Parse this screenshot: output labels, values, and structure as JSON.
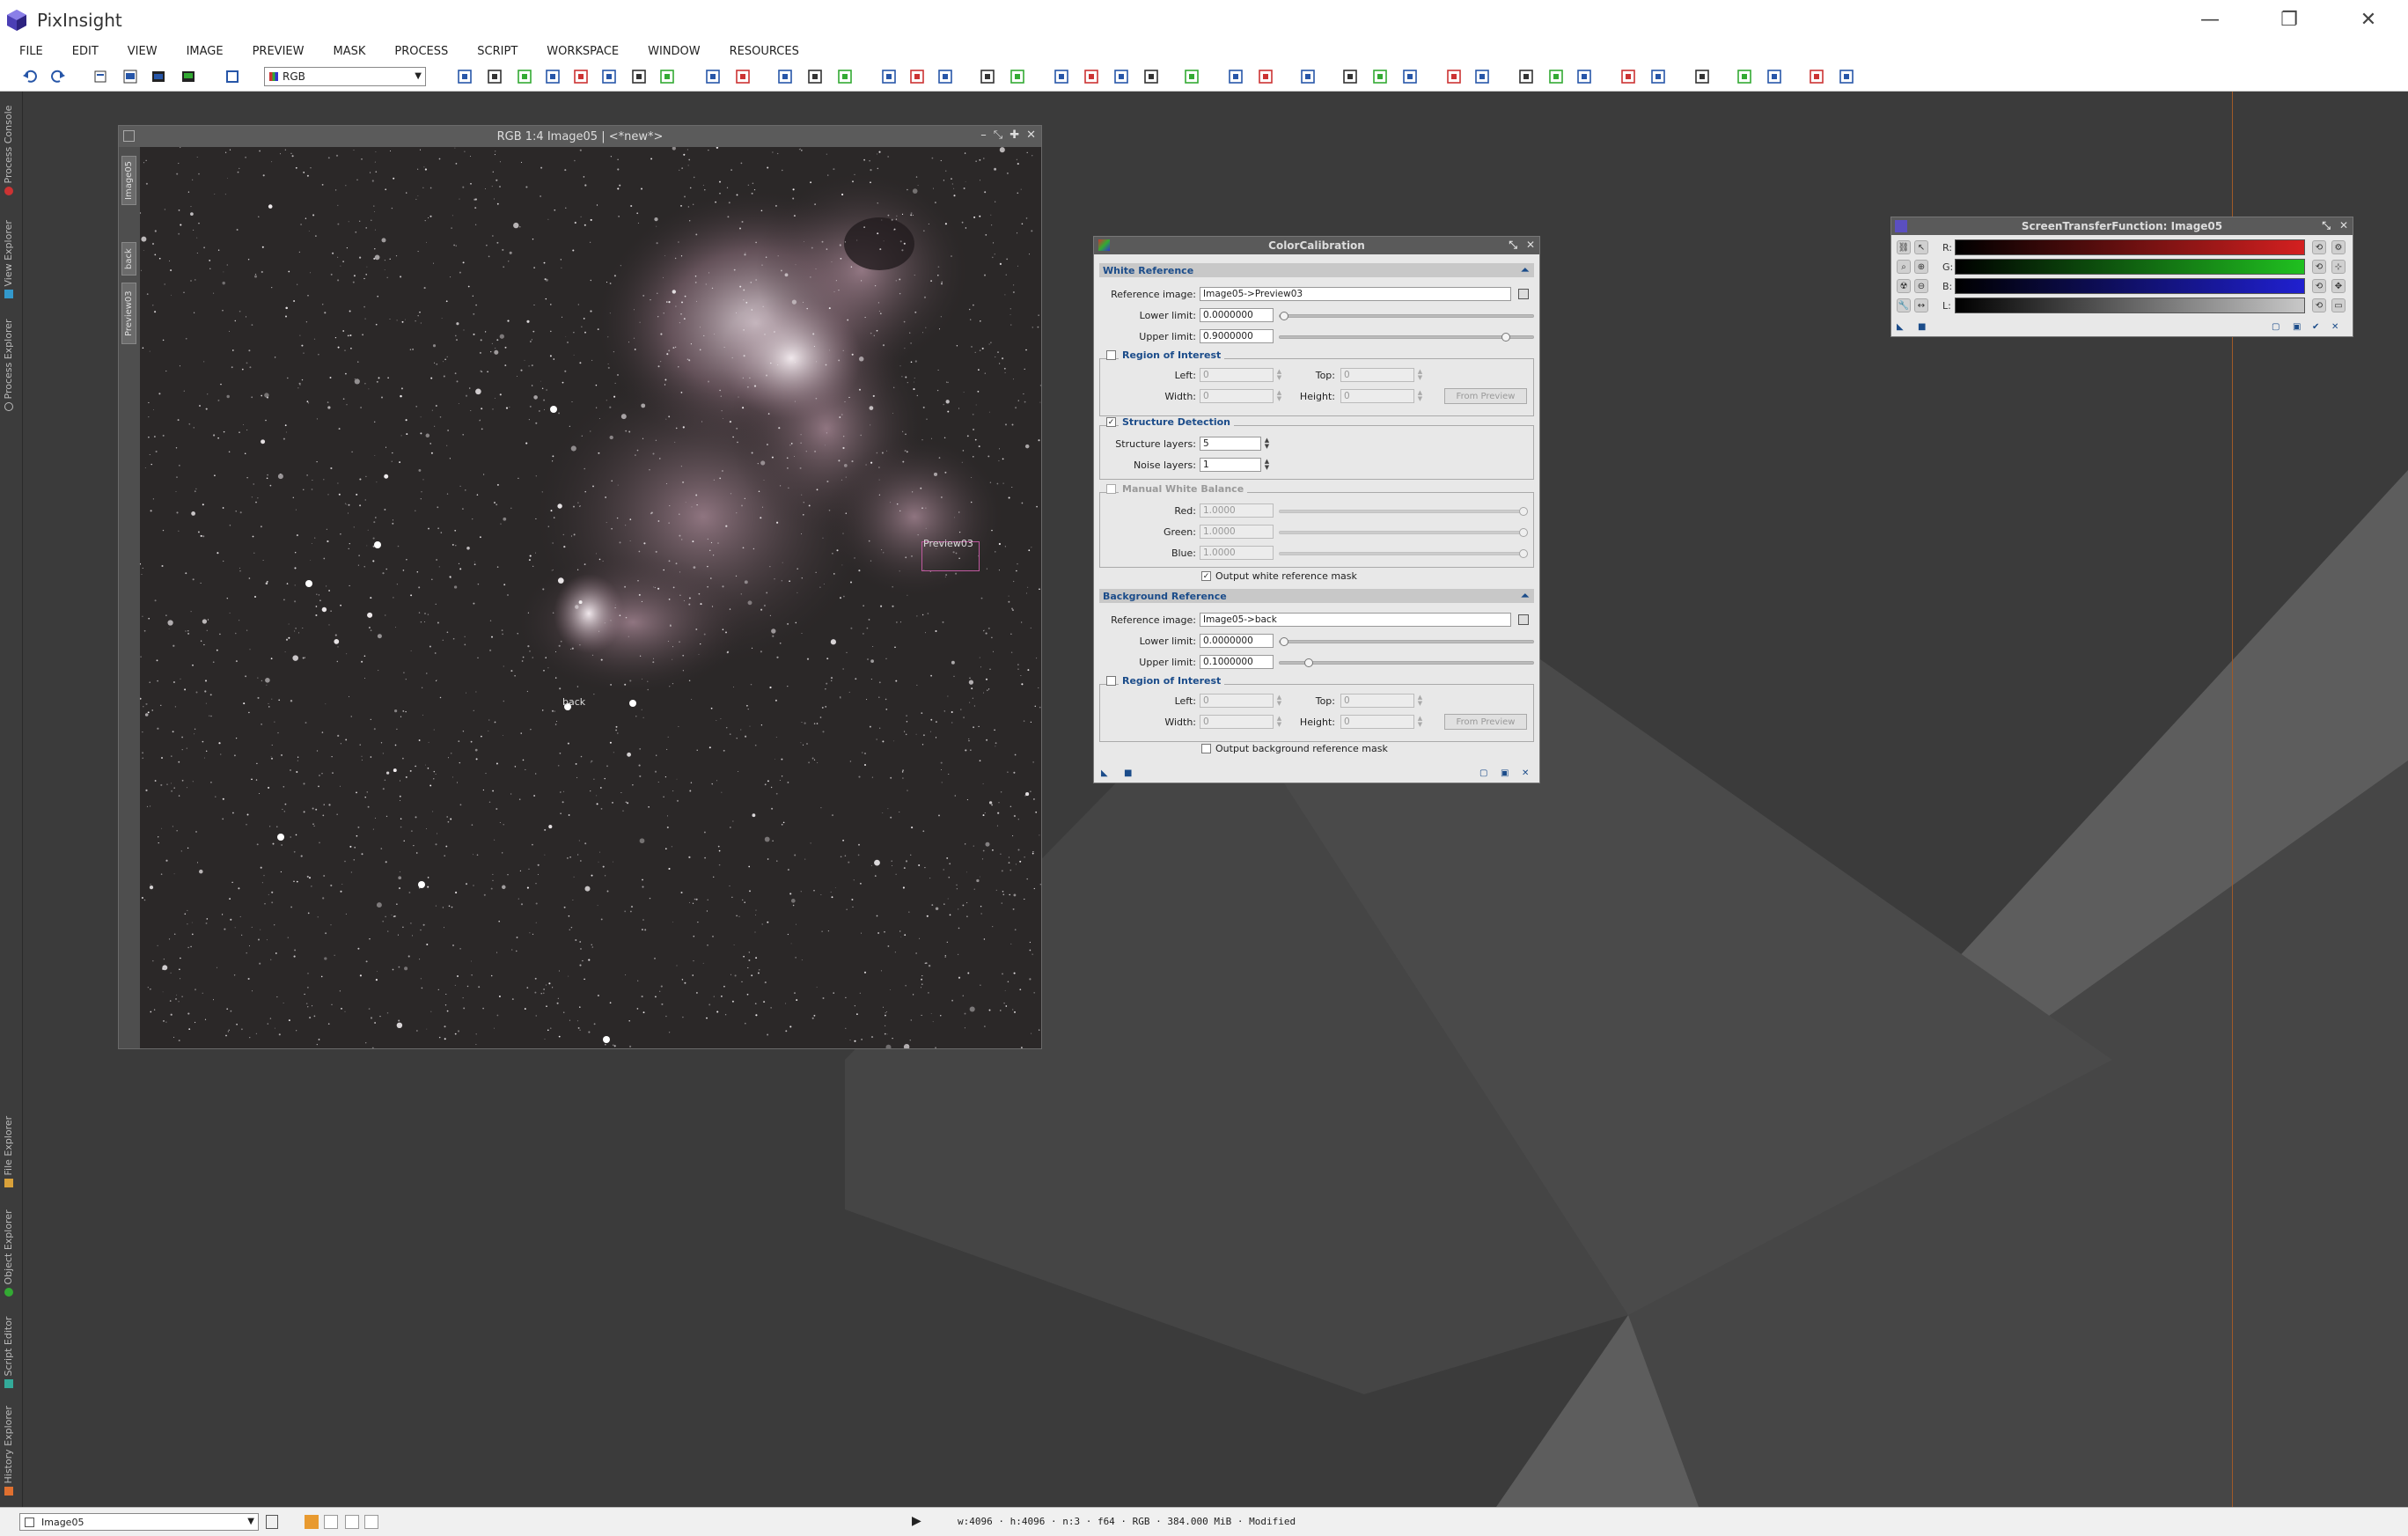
{
  "app": {
    "title": "PixInsight"
  },
  "window_buttons": {
    "minimize": "—",
    "restore": "❐",
    "close": "✕"
  },
  "menu": [
    "FILE",
    "EDIT",
    "VIEW",
    "IMAGE",
    "PREVIEW",
    "MASK",
    "PROCESS",
    "SCRIPT",
    "WORKSPACE",
    "WINDOW",
    "RESOURCES"
  ],
  "toolbar": {
    "color_space_select": "RGB"
  },
  "side_tabs": {
    "process_console": "Process Console",
    "view_explorer": "View Explorer",
    "process_explorer": "Process Explorer",
    "file_explorer": "File Explorer",
    "object_explorer": "Object Explorer",
    "script_editor": "Script Editor",
    "history_explorer": "History Explorer"
  },
  "image_window": {
    "title": "RGB 1:4 Image05 | <*new*>",
    "tabs": [
      "Image05",
      "back",
      "Preview03"
    ],
    "preview_labels": {
      "preview03": "Preview03",
      "back": "back"
    }
  },
  "color_calibration": {
    "title": "ColorCalibration",
    "white_reference": {
      "header": "White Reference",
      "reference_image_label": "Reference image:",
      "reference_image": "Image05->Preview03",
      "lower_limit_label": "Lower limit:",
      "lower_limit": "0.0000000",
      "upper_limit_label": "Upper limit:",
      "upper_limit": "0.9000000",
      "roi": {
        "title": "Region of Interest",
        "left_label": "Left:",
        "left": "0",
        "top_label": "Top:",
        "top": "0",
        "width_label": "Width:",
        "width": "0",
        "height_label": "Height:",
        "height": "0",
        "from_preview": "From Preview"
      },
      "structure_detection": {
        "title": "Structure Detection",
        "structure_layers_label": "Structure layers:",
        "structure_layers": "5",
        "noise_layers_label": "Noise layers:",
        "noise_layers": "1"
      },
      "manual_white_balance": {
        "title": "Manual White Balance",
        "red_label": "Red:",
        "red": "1.0000",
        "green_label": "Green:",
        "green": "1.0000",
        "blue_label": "Blue:",
        "blue": "1.0000"
      },
      "output_mask": "Output white reference mask"
    },
    "background_reference": {
      "header": "Background Reference",
      "reference_image_label": "Reference image:",
      "reference_image": "Image05->back",
      "lower_limit_label": "Lower limit:",
      "lower_limit": "0.0000000",
      "upper_limit_label": "Upper limit:",
      "upper_limit": "0.1000000",
      "roi": {
        "title": "Region of Interest",
        "left_label": "Left:",
        "left": "0",
        "top_label": "Top:",
        "top": "0",
        "width_label": "Width:",
        "width": "0",
        "height_label": "Height:",
        "height": "0",
        "from_preview": "From Preview"
      },
      "output_mask": "Output background reference mask"
    }
  },
  "stf": {
    "title": "ScreenTransferFunction: Image05",
    "channels": [
      "R:",
      "G:",
      "B:",
      "L:"
    ],
    "colors": {
      "R": "#d42020",
      "G": "#20c020",
      "B": "#2020d0",
      "L": "#c8c8c8"
    }
  },
  "status": {
    "view": "Image05",
    "info": "w:4096 · h:4096 · n:3 · f64 · RGB · 384.000 MiB · Modified"
  }
}
